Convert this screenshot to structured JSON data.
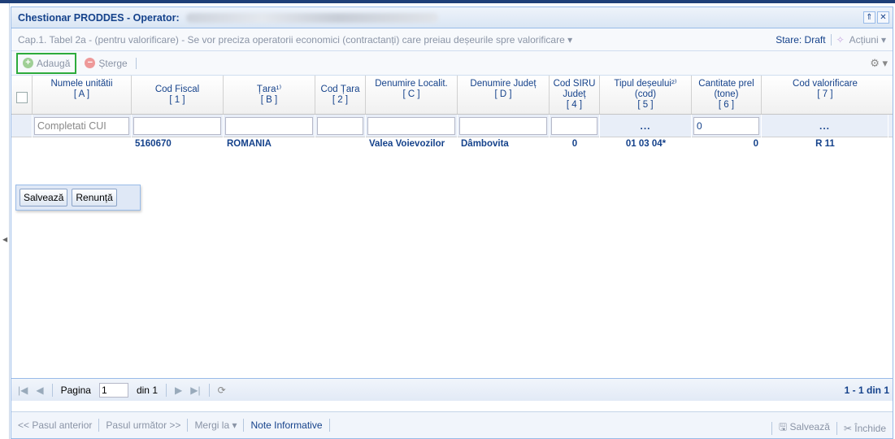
{
  "window": {
    "title": "Chestionar PRODDES - Operator:",
    "collapse_icon": "chevrons-up-icon",
    "close_icon": "close-icon"
  },
  "subheader": {
    "chapter": "Cap.1. Tabel 2a - (pentru valorificare) - Se vor preciza operatorii economici (contractanți) care preiau deșeurile spre valorificare ▾",
    "status": "Stare: Draft",
    "actions_label": "Acțiuni ▾"
  },
  "toolbar": {
    "add_label": "Adaugă",
    "delete_label": "Șterge",
    "settings_icon": "gear-icon"
  },
  "grid": {
    "headers": [
      {
        "line1": "Numele unitătii",
        "line2": "",
        "line3": "[ A ]"
      },
      {
        "line1": "Cod Fiscal",
        "line2": "",
        "line3": "[ 1 ]"
      },
      {
        "line1": "Țara¹⁾",
        "line2": "",
        "line3": "[ B ]"
      },
      {
        "line1": "Cod Țara",
        "line2": "",
        "line3": "[ 2 ]"
      },
      {
        "line1": "Denumire Localit.",
        "line2": "",
        "line3": "[ C ]"
      },
      {
        "line1": "Denumire Județ",
        "line2": "",
        "line3": "[ D ]"
      },
      {
        "line1": "Cod SIRU",
        "line2": "Județ",
        "line3": "[ 4 ]"
      },
      {
        "line1": "Tipul deșeului²⁾",
        "line2": "(cod)",
        "line3": "[ 5 ]"
      },
      {
        "line1": "Cantitate prel",
        "line2": "(tone)",
        "line3": "[ 6 ]"
      },
      {
        "line1": "Cod valorificare",
        "line2": "",
        "line3": "[ 7 ]"
      }
    ],
    "edit_row": {
      "cui_placeholder": "Completati CUI",
      "waste_type": "...",
      "quantity": "0",
      "recovery_code": "..."
    },
    "data_row": {
      "fiscal_code": "5160670",
      "country": "ROMANIA",
      "locality": "Valea Voievozilor",
      "county": "Dâmbovita",
      "siruta": "0",
      "waste_code": "01 03 04*",
      "quantity": "0",
      "recovery_code": "R 11"
    },
    "popup": {
      "save_label": "Salvează",
      "cancel_label": "Renunță"
    }
  },
  "pager": {
    "page_label": "Pagina",
    "page_value": "1",
    "of_label": "din 1",
    "count": "1 - 1 din 1"
  },
  "footer": {
    "prev_step": "<< Pasul anterior",
    "next_step": "Pasul următor >>",
    "goto": "Mergi la ▾",
    "notes": "Note Informative",
    "save": "Salvează",
    "close": "Închide"
  },
  "colors": {
    "accent": "#15428b",
    "highlight_border": "#2dab3c",
    "panel_border": "#99bbe8"
  }
}
